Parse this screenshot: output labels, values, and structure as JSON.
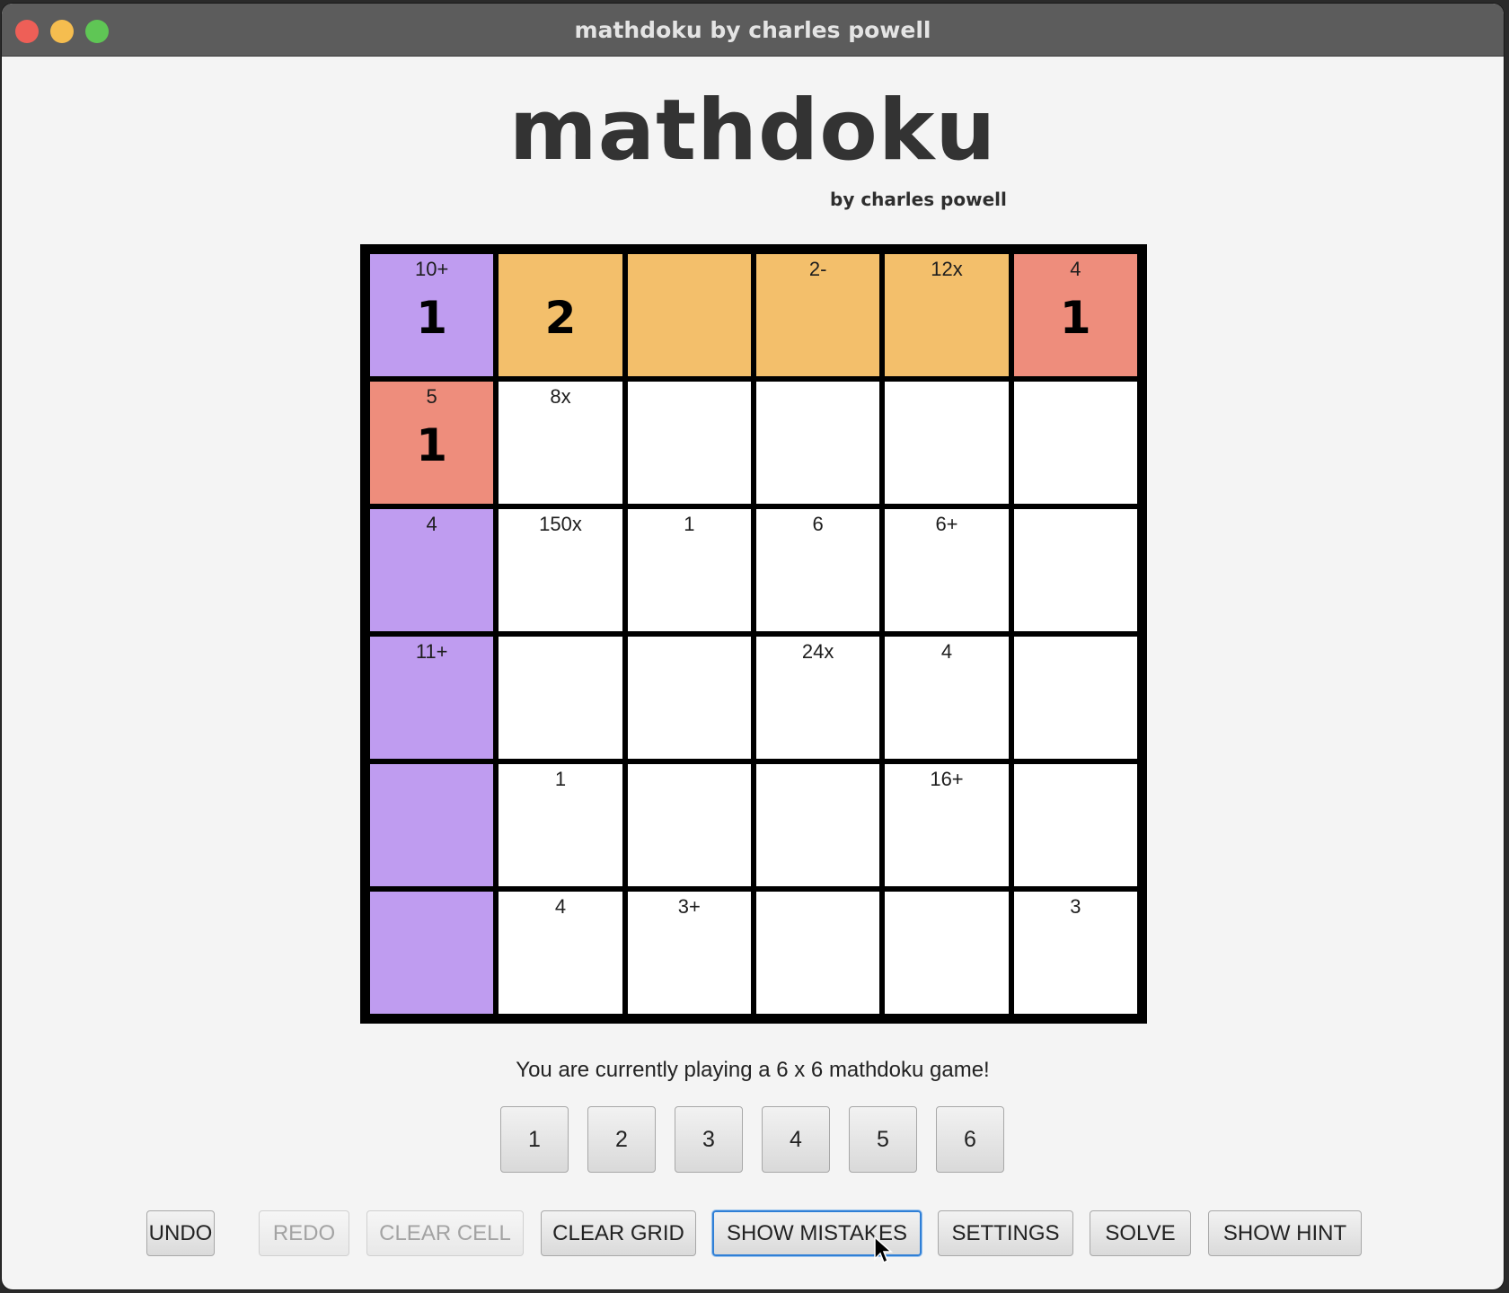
{
  "window": {
    "title": "mathdoku by charles powell"
  },
  "app": {
    "title": "mathdoku",
    "subtitle": "by charles powell"
  },
  "colors": {
    "purple": "#bf9cf0",
    "orange": "#f3bf6b",
    "salmon": "#ee8d7c",
    "white": "#ffffff"
  },
  "grid": {
    "size": 6,
    "cells": [
      [
        {
          "clue": "10+",
          "value": "1",
          "color": "purple"
        },
        {
          "clue": "",
          "value": "2",
          "color": "orange"
        },
        {
          "clue": "",
          "value": "",
          "color": "orange"
        },
        {
          "clue": "2-",
          "value": "",
          "color": "orange"
        },
        {
          "clue": "12x",
          "value": "",
          "color": "orange"
        },
        {
          "clue": "4",
          "value": "1",
          "color": "salmon"
        }
      ],
      [
        {
          "clue": "5",
          "value": "1",
          "color": "salmon"
        },
        {
          "clue": "8x",
          "value": "",
          "color": "white"
        },
        {
          "clue": "",
          "value": "",
          "color": "white"
        },
        {
          "clue": "",
          "value": "",
          "color": "white"
        },
        {
          "clue": "",
          "value": "",
          "color": "white"
        },
        {
          "clue": "",
          "value": "",
          "color": "white"
        }
      ],
      [
        {
          "clue": "4",
          "value": "",
          "color": "purple"
        },
        {
          "clue": "150x",
          "value": "",
          "color": "white"
        },
        {
          "clue": "1",
          "value": "",
          "color": "white"
        },
        {
          "clue": "6",
          "value": "",
          "color": "white"
        },
        {
          "clue": "6+",
          "value": "",
          "color": "white"
        },
        {
          "clue": "",
          "value": "",
          "color": "white"
        }
      ],
      [
        {
          "clue": "11+",
          "value": "",
          "color": "purple"
        },
        {
          "clue": "",
          "value": "",
          "color": "white"
        },
        {
          "clue": "",
          "value": "",
          "color": "white"
        },
        {
          "clue": "24x",
          "value": "",
          "color": "white"
        },
        {
          "clue": "4",
          "value": "",
          "color": "white"
        },
        {
          "clue": "",
          "value": "",
          "color": "white"
        }
      ],
      [
        {
          "clue": "",
          "value": "",
          "color": "purple"
        },
        {
          "clue": "1",
          "value": "",
          "color": "white"
        },
        {
          "clue": "",
          "value": "",
          "color": "white"
        },
        {
          "clue": "",
          "value": "",
          "color": "white"
        },
        {
          "clue": "16+",
          "value": "",
          "color": "white"
        },
        {
          "clue": "",
          "value": "",
          "color": "white"
        }
      ],
      [
        {
          "clue": "",
          "value": "",
          "color": "purple"
        },
        {
          "clue": "4",
          "value": "",
          "color": "white"
        },
        {
          "clue": "3+",
          "value": "",
          "color": "white"
        },
        {
          "clue": "",
          "value": "",
          "color": "white"
        },
        {
          "clue": "",
          "value": "",
          "color": "white"
        },
        {
          "clue": "3",
          "value": "",
          "color": "white"
        }
      ]
    ]
  },
  "status": "You are currently playing a 6 x 6 mathdoku game!",
  "number_buttons": [
    "1",
    "2",
    "3",
    "4",
    "5",
    "6"
  ],
  "controls": {
    "undo": "UNDO",
    "redo": "REDO",
    "clear_cell": "CLEAR CELL",
    "clear_grid": "CLEAR GRID",
    "show_mistakes": "SHOW MISTAKES",
    "settings": "SETTINGS",
    "solve": "SOLVE",
    "show_hint": "SHOW HINT"
  }
}
